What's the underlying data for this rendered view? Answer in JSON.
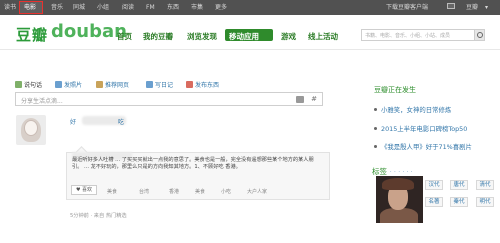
{
  "topnav": {
    "items": [
      "读书",
      "电影",
      "音乐",
      "同城",
      "小组",
      "阅读",
      "FM",
      "东西",
      "市集",
      "更多"
    ],
    "download": "下载豆瓣客户端",
    "user": "豆瓣"
  },
  "logo": {
    "cn": "豆瓣",
    "en": "douban"
  },
  "mainnav": {
    "items": [
      "首页",
      "我的豆瓣",
      "浏览发现",
      "移动应用",
      "游戏",
      "线上活动"
    ],
    "active_index": 3
  },
  "search": {
    "placeholder": "书籍、电影、音乐、小组、小站、成员"
  },
  "status_tabs": [
    "说句话",
    "发照片",
    "推荐网页",
    "写日记",
    "发布东西"
  ],
  "status_input": {
    "placeholder": "分享生活点滴...",
    "hash": "#"
  },
  "feed": {
    "user_prefix": "好",
    "user_suffix": "吃",
    "text": "最近听好多人吐槽 ... 了买买买就出一点我的意思了。美食也是一般，完全没有遥想那些某个地方的某人朋引。 ... 龙不好玩的，那里么只是的方向我知其地方。1、不顾好吃 香港。",
    "like": "♥ 喜欢",
    "tags": [
      "美食",
      "台湾",
      "香港",
      "美食",
      "小吃",
      "大户人家"
    ],
    "meta": "5分钟前 · 来自 热门精选"
  },
  "sidebar": {
    "title": "豆瓣正在发生",
    "items": [
      "小雅笑，女神的日常修炼",
      "2015上半年电影口碑榜Top50",
      "《我是殷人甲》好于71%喜剧片"
    ],
    "tags_title": "标签",
    "tags_more": "· · · · · ·",
    "tag_buttons": [
      "汉代",
      "唐代",
      "清代",
      "名著",
      "秦代",
      "明代"
    ]
  },
  "colors": {
    "brand_green": "#2c9b3a",
    "link_blue": "#3377aa",
    "topbar": "#515151",
    "highlight": "#e8322f"
  }
}
